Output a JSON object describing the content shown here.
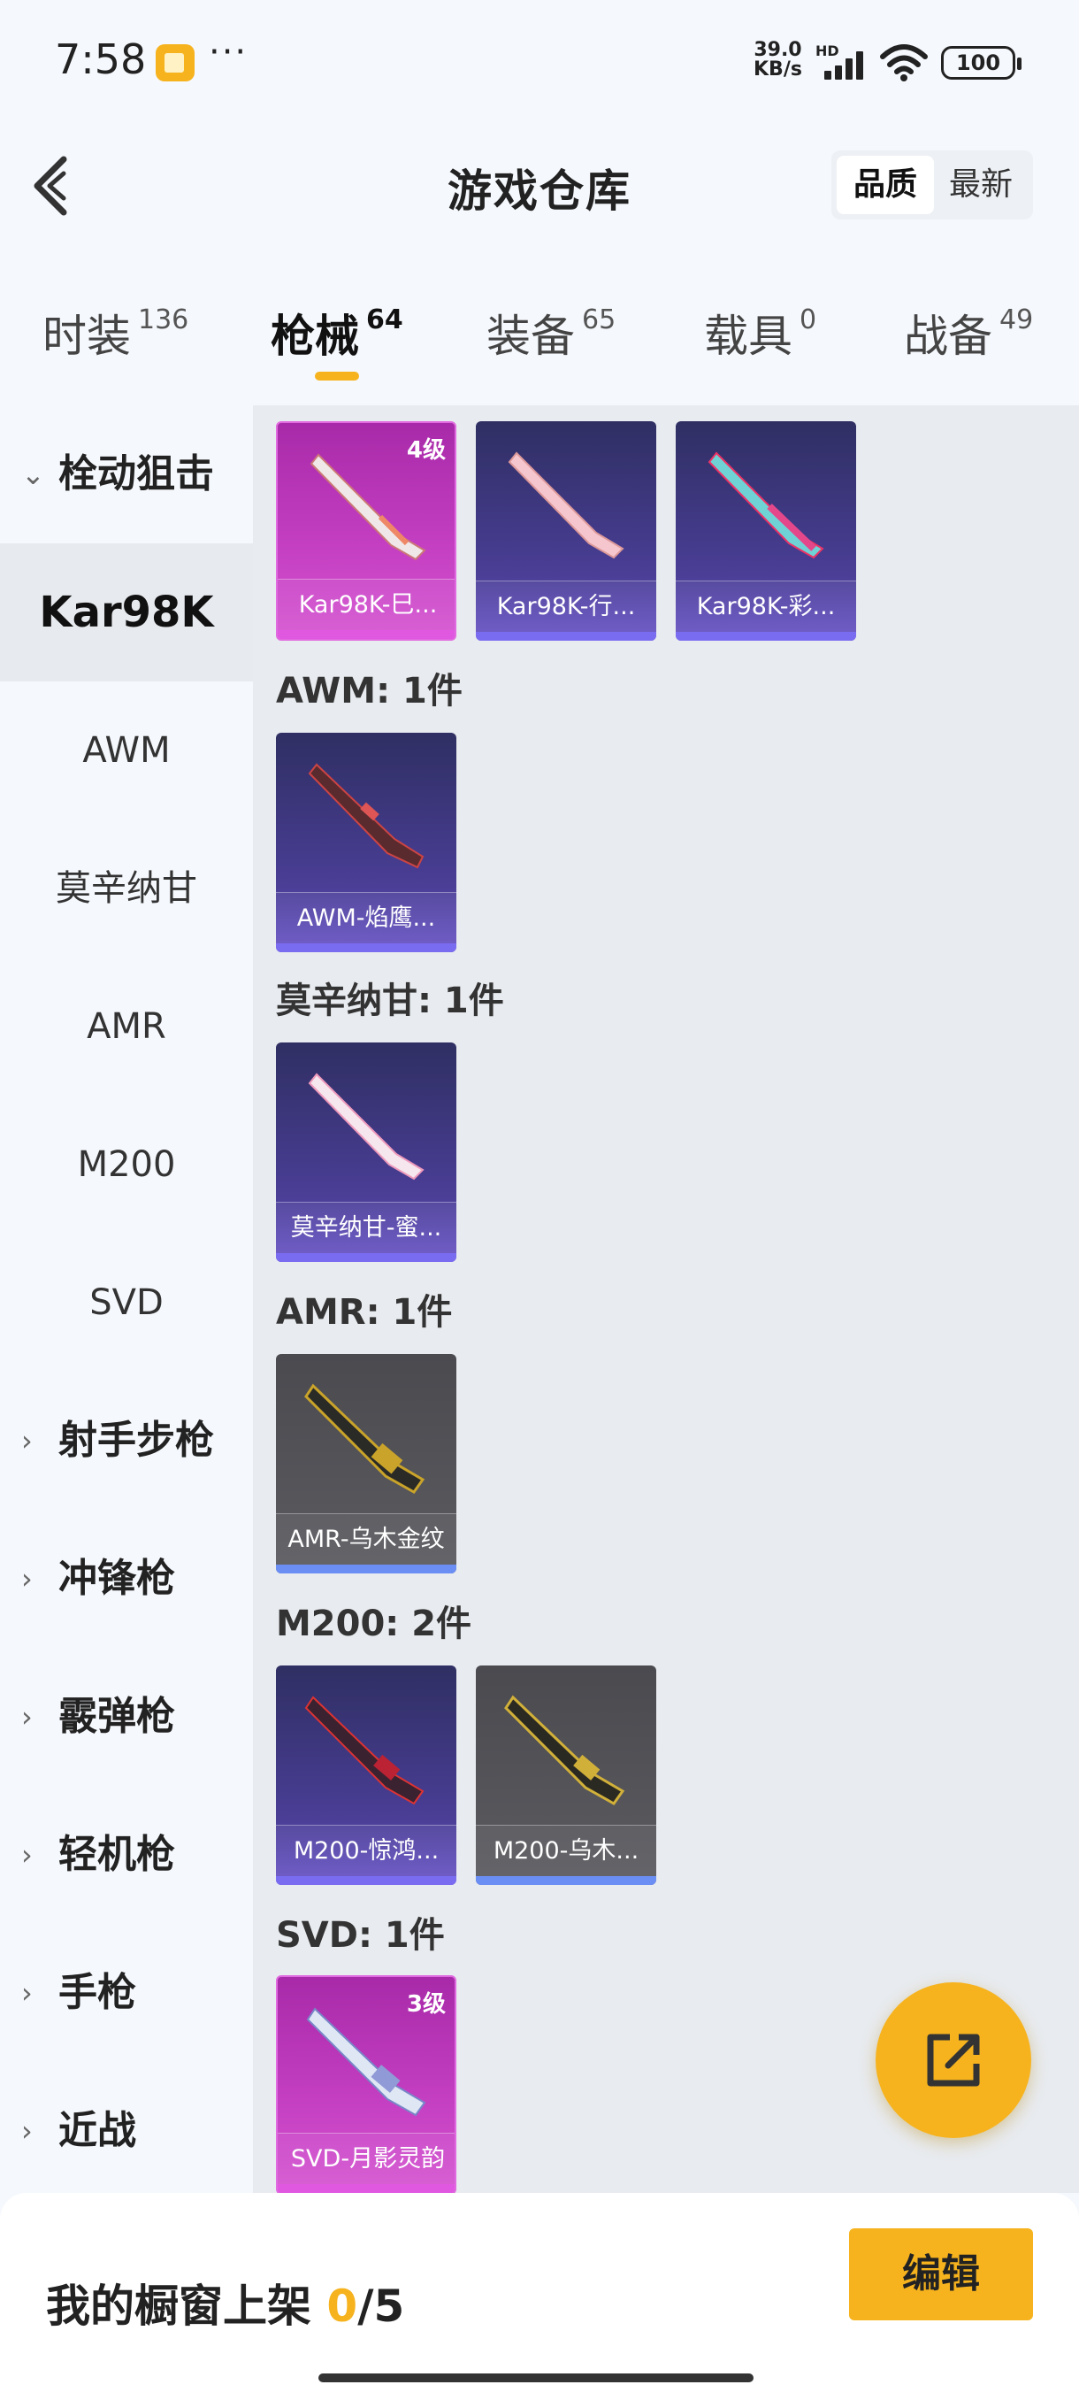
{
  "status_bar": {
    "time": "7:58",
    "more": "···",
    "net_speed_value": "39.0",
    "net_speed_unit": "KB/s",
    "hd": "HD",
    "battery": "100"
  },
  "header": {
    "title": "游戏仓库",
    "sort_options": [
      "品质",
      "最新"
    ]
  },
  "tabs": [
    {
      "label": "时装",
      "count": "136"
    },
    {
      "label": "枪械",
      "count": "64"
    },
    {
      "label": "装备",
      "count": "65"
    },
    {
      "label": "载具",
      "count": "0"
    },
    {
      "label": "战备",
      "count": "49"
    }
  ],
  "sidebar": {
    "category_open": "栓动狙击",
    "sub_items": [
      "Kar98K",
      "AWM",
      "莫辛纳甘",
      "AMR",
      "M200",
      "SVD"
    ],
    "categories": [
      "射手步枪",
      "冲锋枪",
      "霰弹枪",
      "轻机枪",
      "手枪",
      "近战"
    ]
  },
  "groups": [
    {
      "title": "",
      "items": [
        {
          "name": "Kar98K-巳...",
          "level": "4级",
          "rarity": "magenta"
        },
        {
          "name": "Kar98K-行...",
          "level": "",
          "rarity": "purple"
        },
        {
          "name": "Kar98K-彩...",
          "level": "",
          "rarity": "purple"
        }
      ]
    },
    {
      "title": "AWM: 1件",
      "items": [
        {
          "name": "AWM-焰鹰...",
          "level": "",
          "rarity": "purple"
        }
      ]
    },
    {
      "title": "莫辛纳甘: 1件",
      "items": [
        {
          "name": "莫辛纳甘-蜜...",
          "level": "",
          "rarity": "purple"
        }
      ]
    },
    {
      "title": "AMR: 1件",
      "items": [
        {
          "name": "AMR-乌木金纹",
          "level": "",
          "rarity": "grey"
        }
      ]
    },
    {
      "title": "M200: 2件",
      "items": [
        {
          "name": "M200-惊鸿...",
          "level": "",
          "rarity": "purple"
        },
        {
          "name": "M200-乌木...",
          "level": "",
          "rarity": "grey"
        }
      ]
    },
    {
      "title": "SVD: 1件",
      "items": [
        {
          "name": "SVD-月影灵韵",
          "level": "3级",
          "rarity": "magenta"
        }
      ]
    }
  ],
  "share_button": {
    "icon": "share-icon"
  },
  "bottom_bar": {
    "label": "我的橱窗上架",
    "current": "0",
    "total": "/5",
    "edit": "编辑"
  },
  "colors": {
    "accent": "#f6b31e",
    "purple_card": "#4a3e96",
    "magenta_card": "#c33ec1",
    "grey_card": "#5b5b60"
  }
}
